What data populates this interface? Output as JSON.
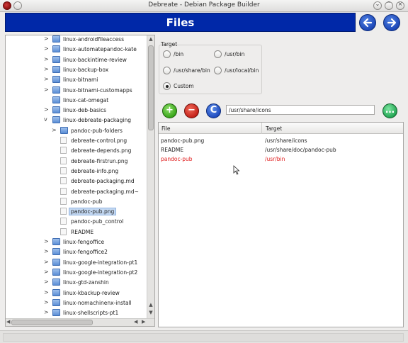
{
  "window": {
    "title": "Debreate - Debian Package Builder"
  },
  "header": {
    "title": "Files"
  },
  "tree": {
    "rows": [
      {
        "label": "linux-androidfileaccess",
        "type": "folder",
        "expander": ">",
        "depth": 1
      },
      {
        "label": "linux-automatepandoc-kate",
        "type": "folder",
        "expander": ">",
        "depth": 1
      },
      {
        "label": "linux-backintime-review",
        "type": "folder",
        "expander": ">",
        "depth": 1
      },
      {
        "label": "linux-backup-box",
        "type": "folder",
        "expander": ">",
        "depth": 1
      },
      {
        "label": "linux-bitnami",
        "type": "folder",
        "expander": ">",
        "depth": 1
      },
      {
        "label": "linux-bitnami-customapps",
        "type": "folder",
        "expander": ">",
        "depth": 1
      },
      {
        "label": "linux-cat-omegat",
        "type": "folder",
        "expander": "",
        "depth": 1
      },
      {
        "label": "linux-deb-basics",
        "type": "folder",
        "expander": ">",
        "depth": 1
      },
      {
        "label": "linux-debreate-packaging",
        "type": "folder",
        "expander": "v",
        "depth": 1
      },
      {
        "label": "pandoc-pub-folders",
        "type": "folder",
        "expander": ">",
        "depth": 2
      },
      {
        "label": "debreate-control.png",
        "type": "file",
        "expander": "",
        "depth": 2
      },
      {
        "label": "debreate-depends.png",
        "type": "file",
        "expander": "",
        "depth": 2
      },
      {
        "label": "debreate-firstrun.png",
        "type": "file",
        "expander": "",
        "depth": 2
      },
      {
        "label": "debreate-info.png",
        "type": "file",
        "expander": "",
        "depth": 2
      },
      {
        "label": "debreate-packaging.md",
        "type": "file",
        "expander": "",
        "depth": 2
      },
      {
        "label": "debreate-packaging.md~",
        "type": "file",
        "expander": "",
        "depth": 2
      },
      {
        "label": "pandoc-pub",
        "type": "file",
        "expander": "",
        "depth": 2
      },
      {
        "label": "pandoc-pub.png",
        "type": "file",
        "expander": "",
        "depth": 2,
        "selected": true
      },
      {
        "label": "pandoc-pub_control",
        "type": "file",
        "expander": "",
        "depth": 2
      },
      {
        "label": "README",
        "type": "file",
        "expander": "",
        "depth": 2
      },
      {
        "label": "linux-fengoffice",
        "type": "folder",
        "expander": ">",
        "depth": 1
      },
      {
        "label": "linux-fengoffice2",
        "type": "folder",
        "expander": ">",
        "depth": 1
      },
      {
        "label": "linux-google-integration-pt1",
        "type": "folder",
        "expander": ">",
        "depth": 1
      },
      {
        "label": "linux-google-integration-pt2",
        "type": "folder",
        "expander": ">",
        "depth": 1
      },
      {
        "label": "linux-gtd-zanshin",
        "type": "folder",
        "expander": ">",
        "depth": 1
      },
      {
        "label": "linux-kbackup-review",
        "type": "folder",
        "expander": ">",
        "depth": 1
      },
      {
        "label": "linux-nomachinenx-install",
        "type": "folder",
        "expander": ">",
        "depth": 1
      },
      {
        "label": "linux-shellscripts-pt1",
        "type": "folder",
        "expander": ">",
        "depth": 1
      }
    ]
  },
  "target": {
    "label": "Target",
    "options": [
      {
        "label": "/bin",
        "checked": false
      },
      {
        "label": "/usr/bin",
        "checked": false
      },
      {
        "label": "/usr/share/bin",
        "checked": false
      },
      {
        "label": "/usr/local/bin",
        "checked": false
      },
      {
        "label": "Custom",
        "checked": true
      }
    ]
  },
  "actions": {
    "add_glyph": "+",
    "remove_glyph": "−",
    "refresh_glyph": "C",
    "browse_glyph": "…",
    "path_value": "/usr/share/icons"
  },
  "files_table": {
    "columns": [
      "File",
      "Target"
    ],
    "rows": [
      {
        "file": "pandoc-pub.png",
        "target": "/usr/share/icons",
        "missing": false
      },
      {
        "file": "README",
        "target": "/usr/share/doc/pandoc-pub",
        "missing": false
      },
      {
        "file": "pandoc-pub",
        "target": "/usr/bin",
        "missing": true
      }
    ]
  },
  "colors": {
    "banner": "#0028a8",
    "missing_file": "#e01a1a",
    "selection": "#c4d9f3"
  },
  "icons": {
    "back": "arrow-left-icon",
    "forward": "arrow-right-icon",
    "folder": "folder-icon",
    "file": "file-icon"
  }
}
